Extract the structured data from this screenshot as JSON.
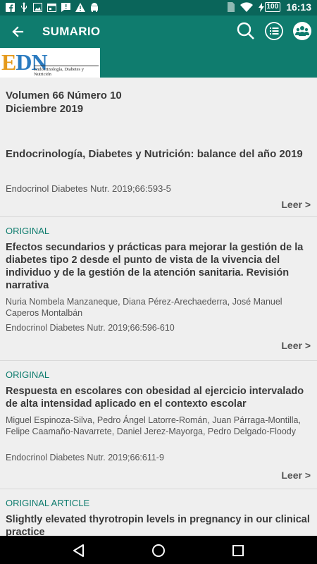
{
  "status_bar": {
    "time": "16:13",
    "battery": "100",
    "icons": [
      "facebook-icon",
      "usb-icon",
      "image-icon",
      "calendar-icon",
      "message-icon",
      "warning-icon",
      "android-icon",
      "sim-icon",
      "wifi-icon",
      "battery-icon"
    ]
  },
  "app_bar": {
    "title": "SUMARIO",
    "icons": [
      "back-arrow-icon",
      "search-icon",
      "list-icon",
      "community-icon"
    ],
    "color": "#0f7c6e"
  },
  "journal_logo": {
    "letters": "EDN",
    "subtitle": "Endocrinología, Diabetes y Nutrición"
  },
  "issue": {
    "volume_line": "Volumen 66 Número 10",
    "date_line": "Diciembre 2019",
    "title": "Endocrinología, Diabetes y Nutrición: balance del año 2019",
    "reference": "Endocrinol Diabetes Nutr. 2019;66:593-5",
    "read_label": "Leer >"
  },
  "articles": [
    {
      "section": "ORIGINAL",
      "title": "Efectos secundarios y prácticas para mejorar la gestión de la diabetes tipo 2 desde el punto de vista de la vivencia del individuo y de la gestión de la atención sanitaria. Revisión narrativa",
      "authors": "Nuria Nombela Manzaneque, Diana Pérez-Arechaederra, José Manuel Caperos Montalbán",
      "reference": "Endocrinol Diabetes Nutr. 2019;66:596-610",
      "read_label": "Leer >"
    },
    {
      "section": "ORIGINAL",
      "title": "Respuesta en escolares con obesidad al ejercicio intervalado de alta intensidad aplicado en el contexto escolar",
      "authors": "Miguel Espinoza-Silva, Pedro Ángel Latorre-Román, Juan Párraga-Montilla, Felipe Caamaño-Navarrete, Daniel Jerez-Mayorga, Pedro Delgado-Floody",
      "reference": "Endocrinol Diabetes Nutr. 2019;66:611-9",
      "read_label": "Leer >"
    },
    {
      "section": "ORIGINAL ARTICLE",
      "title": "Slightly elevated thyrotropin levels in pregnancy in our clinical practice"
    }
  ],
  "nav_bar": {
    "icons": [
      "back-triangle-icon",
      "home-circle-icon",
      "recents-square-icon"
    ]
  }
}
